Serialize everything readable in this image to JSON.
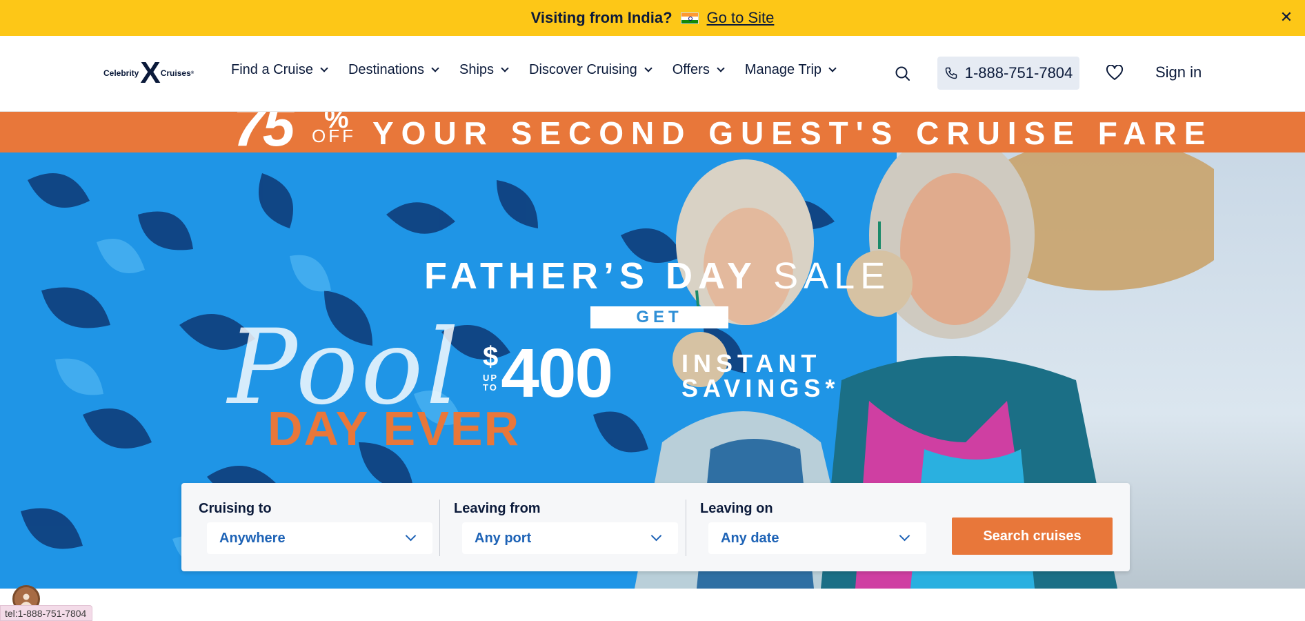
{
  "notice": {
    "question": "Visiting from India?",
    "flag_icon": "india-flag-icon",
    "link": "Go to Site",
    "close_icon": "close-icon"
  },
  "header": {
    "logo": {
      "left": "Celebrity",
      "mark": "X",
      "right": "Cruises"
    },
    "nav": [
      {
        "label": "Find a Cruise"
      },
      {
        "label": "Destinations"
      },
      {
        "label": "Ships"
      },
      {
        "label": "Discover Cruising"
      },
      {
        "label": "Offers"
      },
      {
        "label": "Manage Trip"
      }
    ],
    "phone": "1-888-751-7804",
    "signin": "Sign in"
  },
  "promo": {
    "amount": "75",
    "percent": "%",
    "off": "OFF",
    "text": "YOUR SECOND GUEST'S CRUISE FARE"
  },
  "hero": {
    "headline_bold": "FATHER’S DAY",
    "headline_light": "SALE",
    "get": "GET",
    "dollar": "$",
    "up_to_line1": "UP",
    "up_to_line2": "TO",
    "amount": "400",
    "savings_line1": "INSTANT",
    "savings_line2": "SAVINGS*",
    "script_text": "Pool",
    "day_ever": "DAY EVER"
  },
  "search": {
    "cruising_to": {
      "label": "Cruising to",
      "value": "Anywhere"
    },
    "leaving_from": {
      "label": "Leaving from",
      "value": "Any port"
    },
    "leaving_on": {
      "label": "Leaving on",
      "value": "Any date"
    },
    "button": "Search cruises"
  },
  "status_bar": {
    "url": "tel:1-888-751-7804"
  },
  "colors": {
    "notice_bg": "#fdc717",
    "accent_orange": "#e8773a",
    "navy": "#0b1a3a",
    "link_blue": "#1e63b6",
    "phone_bg": "#e6ebf3"
  }
}
